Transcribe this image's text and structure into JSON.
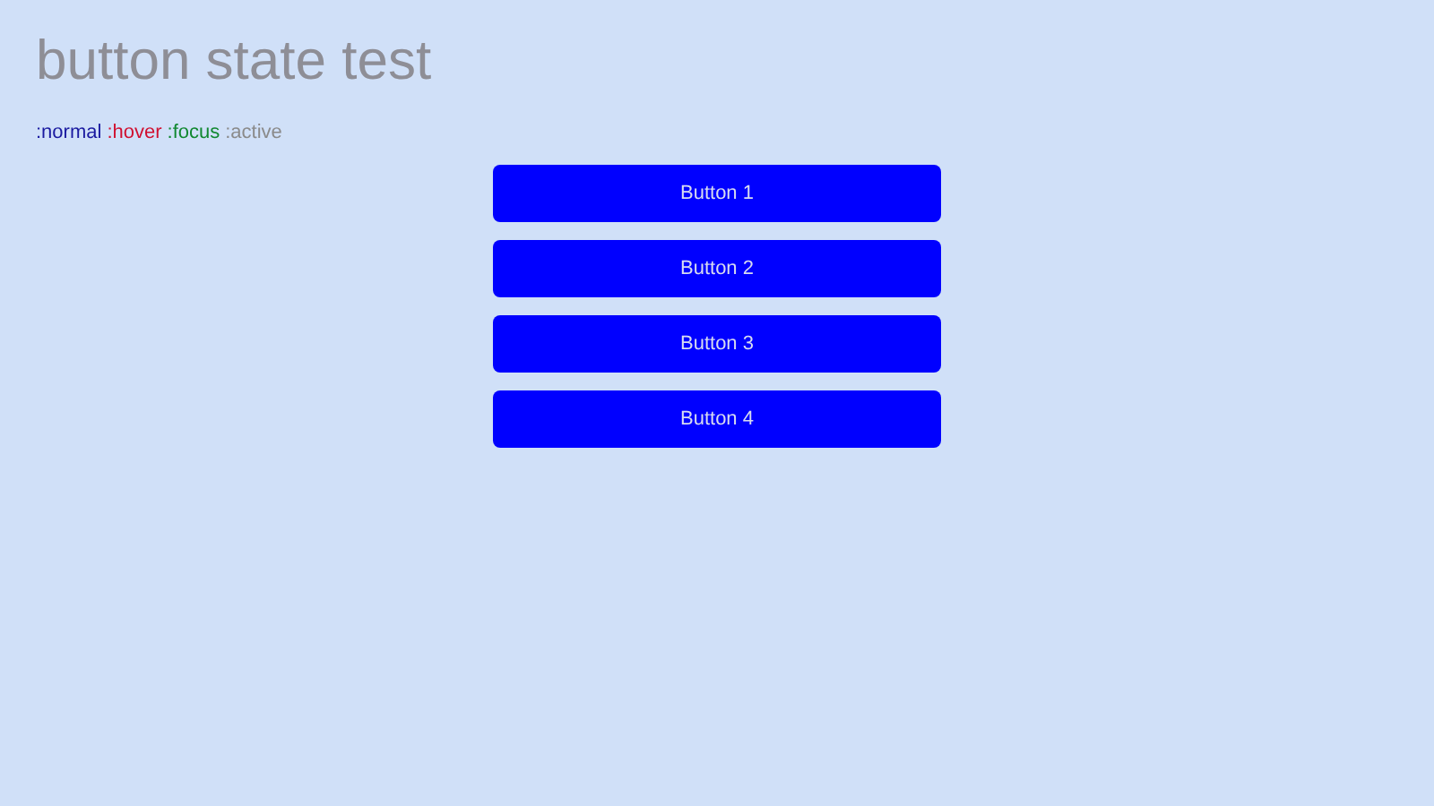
{
  "title": "button state test",
  "legend": [
    {
      "label": ":normal",
      "color": "#1a1aa0"
    },
    {
      "label": ":hover",
      "color": "#d01030"
    },
    {
      "label": ":focus",
      "color": "#108830"
    },
    {
      "label": ":active",
      "color": "#8a8a8a"
    }
  ],
  "buttons": [
    {
      "label": "Button 1"
    },
    {
      "label": "Button 2"
    },
    {
      "label": "Button 3"
    },
    {
      "label": "Button 4"
    }
  ]
}
